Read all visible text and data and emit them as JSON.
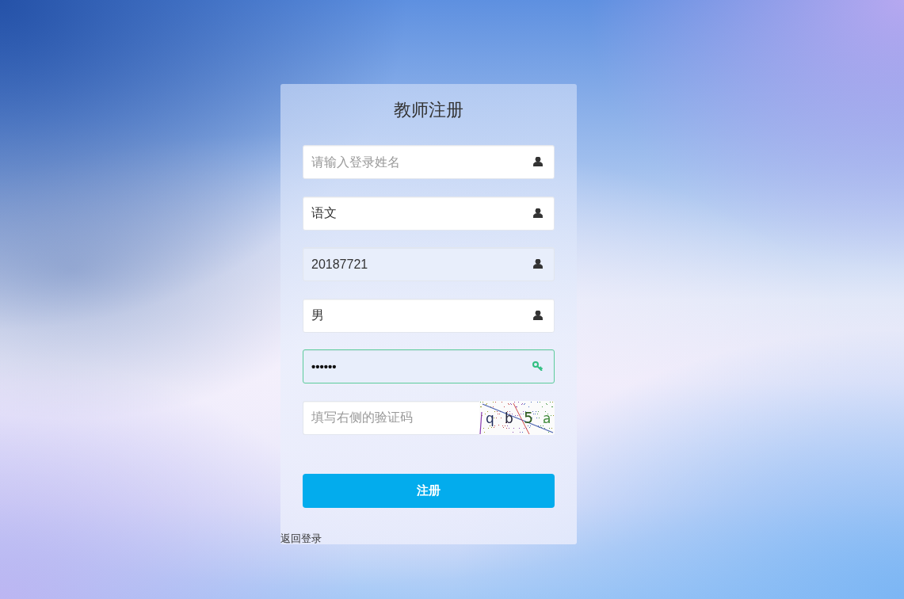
{
  "form": {
    "title": "教师注册",
    "fields": [
      {
        "kind": "text",
        "placeholder": "请输入登录姓名",
        "autofilled": false,
        "valid": false
      },
      {
        "kind": "text",
        "value": "语文",
        "autofilled": false,
        "valid": false
      },
      {
        "kind": "text",
        "value": "20187721",
        "autofilled": true,
        "valid": false
      },
      {
        "kind": "text",
        "value": "男",
        "autofilled": false,
        "valid": false
      },
      {
        "kind": "password",
        "value": "••••••",
        "autofilled": true,
        "valid": true
      },
      {
        "kind": "captcha",
        "placeholder": "填写右侧的验证码",
        "captcha": [
          "q",
          "b",
          "5",
          "a"
        ],
        "autofilled": false,
        "valid": false
      }
    ],
    "submit": "注册",
    "back_link": "返回登录"
  }
}
